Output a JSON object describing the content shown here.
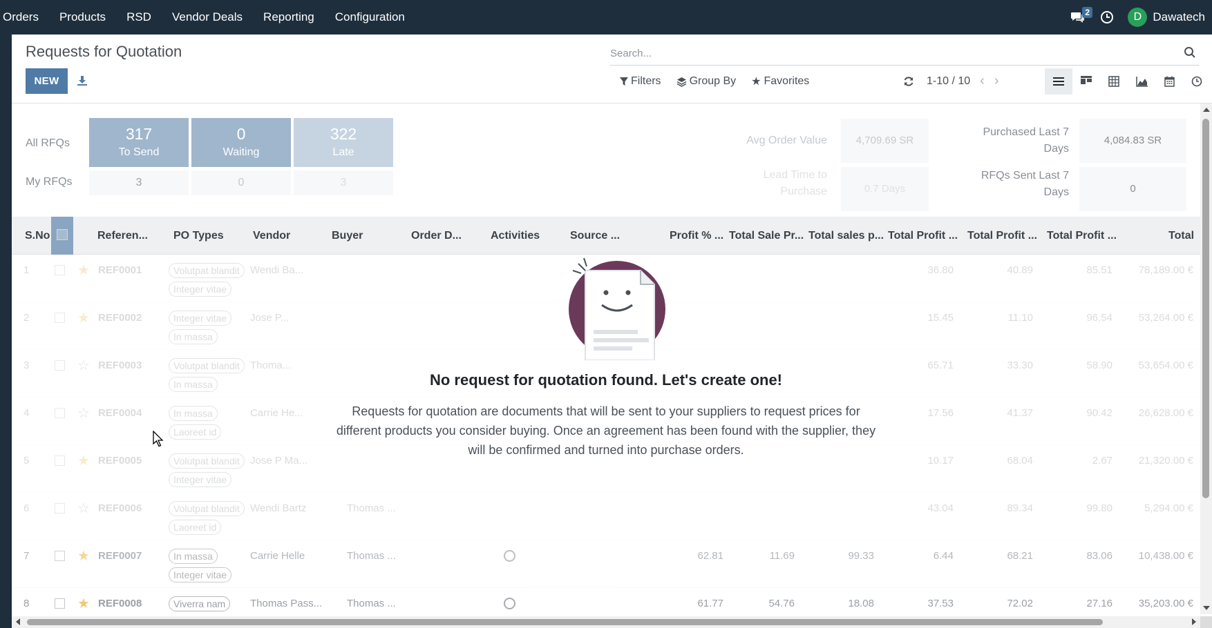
{
  "navbar": {
    "menu": [
      "Orders",
      "Products",
      "RSD",
      "Vendor Deals",
      "Reporting",
      "Configuration"
    ],
    "chat_count": "2",
    "user_initial": "D",
    "user_name": "Dawatech"
  },
  "control_panel": {
    "title": "Requests for Quotation",
    "new_label": "NEW",
    "search_placeholder": "Search...",
    "filters_label": "Filters",
    "groupby_label": "Group By",
    "favorites_label": "Favorites",
    "pager": "1-10 / 10"
  },
  "dashboard": {
    "all_rfqs_label": "All RFQs",
    "my_rfqs_label": "My RFQs",
    "tiles": [
      {
        "value": "317",
        "label": "To Send",
        "mine": "3"
      },
      {
        "value": "0",
        "label": "Waiting",
        "mine": "0"
      },
      {
        "value": "322",
        "label": "Late",
        "mine": "3"
      }
    ],
    "avg_order_label": "Avg Order Value",
    "avg_order_value": "4,709.69 SR",
    "lead_time_label_1": "Lead Time to",
    "lead_time_label_2": "Purchase",
    "lead_time_value": "0.7 Days",
    "purchased_label_1": "Purchased Last 7",
    "purchased_label_2": "Days",
    "purchased_value": "4,084.83 SR",
    "rfqs_sent_label_1": "RFQs Sent Last 7",
    "rfqs_sent_label_2": "Days",
    "rfqs_sent_value": "0"
  },
  "table": {
    "headers": [
      "S.No",
      "Referen...",
      "PO Types",
      "Vendor",
      "Buyer",
      "Order D...",
      "Activities",
      "Source ...",
      "Profit % ...",
      "Total Sale Pr...",
      "Total sales p...",
      "Total Profit ...",
      "Total Profit ...",
      "Total Profit ...",
      "Total"
    ],
    "rows": [
      {
        "sno": "1",
        "star": true,
        "ref": "REF0001",
        "tag1": "Volutpat blandit",
        "tag2": "Integer vitae",
        "vendor": "Wendi Ba...",
        "buyer": "",
        "p": "",
        "s1": "",
        "s2": "",
        "t1": "36.80",
        "t2": "40.89",
        "t3": "85.51",
        "total": "78,189.00 €"
      },
      {
        "sno": "2",
        "star": true,
        "ref": "REF0002",
        "tag1": "Integer vitae",
        "tag2": "In massa",
        "vendor": "Jose P...",
        "buyer": "",
        "p": "",
        "s1": "",
        "s2": "",
        "t1": "15.45",
        "t2": "11.10",
        "t3": "96.54",
        "total": "53,264.00 €"
      },
      {
        "sno": "3",
        "star": false,
        "ref": "REF0003",
        "tag1": "Volutpat blandit",
        "tag2": "In massa",
        "vendor": "Thoma...",
        "buyer": "",
        "p": "",
        "s1": "",
        "s2": "",
        "t1": "65.71",
        "t2": "33.30",
        "t3": "58.90",
        "total": "53,654.00 €"
      },
      {
        "sno": "4",
        "star": false,
        "ref": "REF0004",
        "tag1": "In massa",
        "tag2": "Laoreet id",
        "vendor": "Carrie He...",
        "buyer": "",
        "p": "",
        "s1": "",
        "s2": "",
        "t1": "17.56",
        "t2": "41.37",
        "t3": "90.42",
        "total": "26,628.00 €"
      },
      {
        "sno": "5",
        "star": true,
        "ref": "REF0005",
        "tag1": "Volutpat blandit",
        "tag2": "Integer vitae",
        "vendor": "Jose P Ma...",
        "buyer": "",
        "p": "",
        "s1": "",
        "s2": "",
        "t1": "10.17",
        "t2": "68.04",
        "t3": "2.67",
        "total": "21,320.00 €"
      },
      {
        "sno": "6",
        "star": false,
        "ref": "REF0006",
        "tag1": "Volutpat blandit",
        "tag2": "Laoreet id",
        "vendor": "Wendi Bartz",
        "buyer": "Thomas ...",
        "p": "",
        "s1": "",
        "s2": "",
        "t1": "43.04",
        "t2": "89.34",
        "t3": "99.80",
        "total": "5,294.00 €"
      },
      {
        "sno": "7",
        "star": true,
        "ref": "REF0007",
        "tag1": "In massa",
        "tag2": "Integer vitae",
        "vendor": "Carrie Helle",
        "buyer": "Thomas ...",
        "p": "62.81",
        "s1": "11.69",
        "s2": "99.33",
        "t1": "6.44",
        "t2": "68.21",
        "t3": "83.06",
        "total": "10,438.00 €"
      },
      {
        "sno": "8",
        "star": true,
        "ref": "REF0008",
        "tag1": "Viverra nam",
        "tag2": "",
        "vendor": "Thomas Pass...",
        "buyer": "Thomas ...",
        "p": "61.77",
        "s1": "54.76",
        "s2": "18.08",
        "t1": "37.53",
        "t2": "72.02",
        "t3": "27.16",
        "total": "35,203.00 €"
      }
    ]
  },
  "empty_state": {
    "title": "No request for quotation found. Let's create one!",
    "text": "Requests for quotation are documents that will be sent to your suppliers to request prices for different products you consider buying. Once an agreement has been found with the supplier, they will be confirmed and turned into purchase orders."
  },
  "colors": {
    "navbar": "#1e2e3d",
    "primary": "#4f7ba6",
    "tile": "#9fb6cd",
    "avatar": "#27a05a",
    "illustration": "#6b3a5a"
  }
}
